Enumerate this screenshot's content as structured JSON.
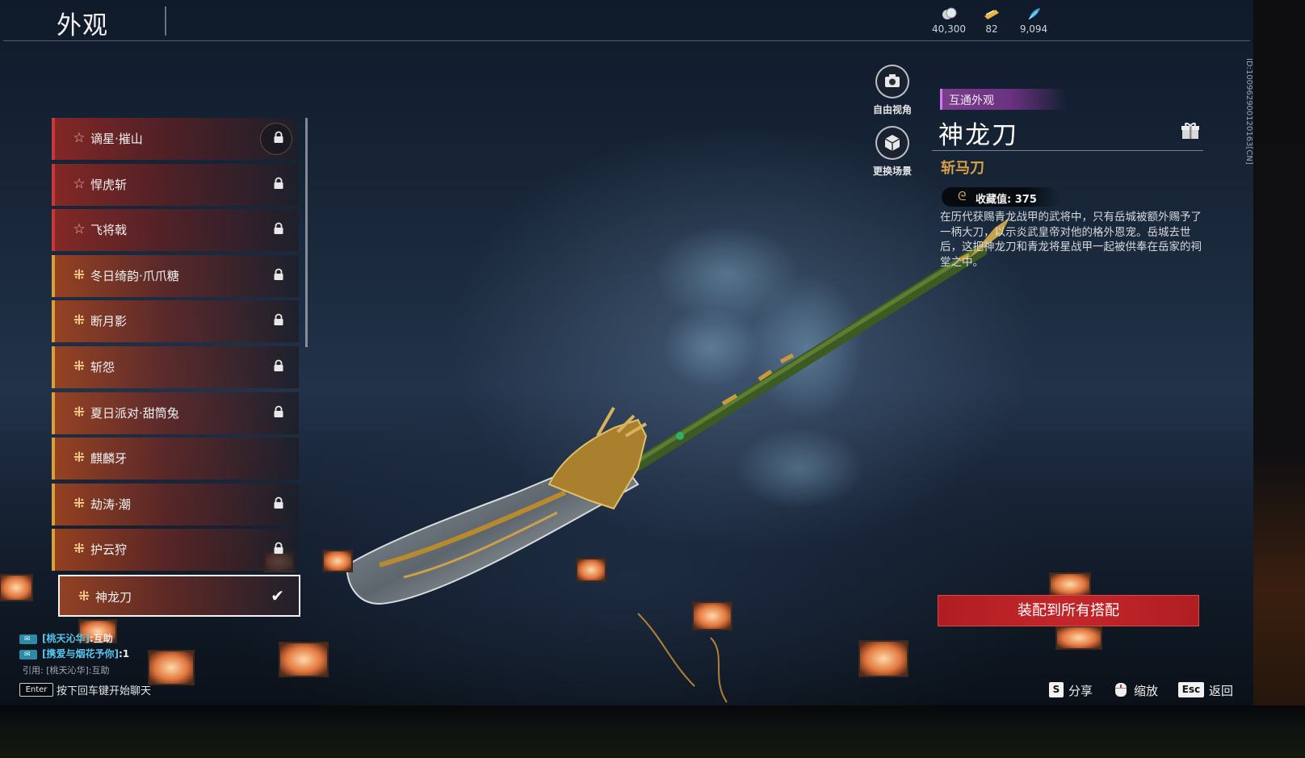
{
  "header": {
    "title": "外观",
    "currencies": [
      {
        "icon": "silver-coin-icon",
        "value": "40,300"
      },
      {
        "icon": "ticket-icon",
        "value": "82"
      },
      {
        "icon": "feather-icon",
        "value": "9,094"
      }
    ]
  },
  "side_id": "ID:100962900120163[CN]",
  "skins": [
    {
      "name": "谪星·摧山",
      "rarity": "red",
      "icon": "star-icon",
      "state": "locked-ring"
    },
    {
      "name": "悍虎斩",
      "rarity": "red",
      "icon": "star-icon",
      "state": "locked"
    },
    {
      "name": "飞将戟",
      "rarity": "red",
      "icon": "star-icon",
      "state": "locked"
    },
    {
      "name": "冬日绮韵·爪爪糖",
      "rarity": "gold",
      "icon": "sparkle-icon",
      "state": "locked"
    },
    {
      "name": "断月影",
      "rarity": "gold",
      "icon": "sparkle-icon",
      "state": "locked"
    },
    {
      "name": "斩怨",
      "rarity": "gold",
      "icon": "sparkle-icon",
      "state": "locked"
    },
    {
      "name": "夏日派对·甜筒兔",
      "rarity": "gold",
      "icon": "sparkle-icon",
      "state": "locked"
    },
    {
      "name": "麒麟牙",
      "rarity": "gold",
      "icon": "sparkle-icon",
      "state": "unlocked"
    },
    {
      "name": "劫涛·潮",
      "rarity": "gold",
      "icon": "sparkle-icon",
      "state": "locked"
    },
    {
      "name": "护云狩",
      "rarity": "gold",
      "icon": "sparkle-icon",
      "state": "locked"
    },
    {
      "name": "神龙刀",
      "rarity": "gold",
      "icon": "sparkle-icon",
      "state": "equipped"
    }
  ],
  "controls": {
    "free_view": "自由视角",
    "change_scene": "更换场景"
  },
  "detail": {
    "tag": "互通外观",
    "name": "神龙刀",
    "type": "斩马刀",
    "collect_label": "收藏值: 375",
    "description": "在历代获赐青龙战甲的武将中，只有岳城被额外赐予了一柄大刀，以示炎武皇帝对他的格外恩宠。岳城去世后，这把神龙刀和青龙将星战甲一起被供奉在岳家的祠堂之中。",
    "equip_button": "装配到所有搭配"
  },
  "chat": {
    "lines": [
      {
        "user": "[桃天沁华]",
        "text": ":互助"
      },
      {
        "user": "[携爱与烟花予你]",
        "text": ":1"
      }
    ],
    "quote": "引用: [桃天沁华]:互助",
    "enter_key": "Enter",
    "enter_hint": "按下回车键开始聊天"
  },
  "hints": {
    "share_key": "S",
    "share": "分享",
    "zoom": "缩放",
    "back_key": "Esc",
    "back": "返回"
  },
  "colors": {
    "accent_red": "#c3262a",
    "gold": "#d8a048",
    "tag_purple": "#7b3d8c"
  }
}
